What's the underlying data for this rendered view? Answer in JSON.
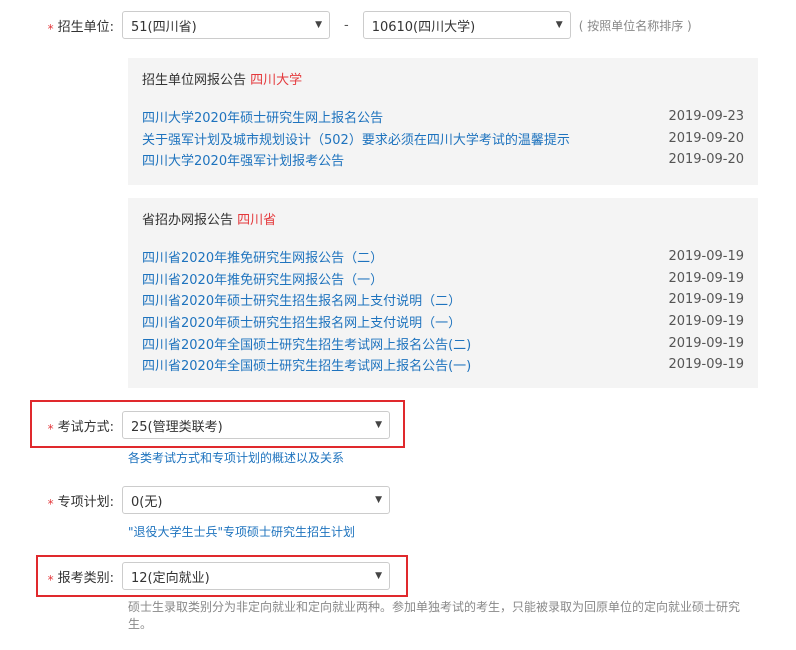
{
  "unit": {
    "label": "招生单位:",
    "province_value": "51(四川省)",
    "school_value": "10610(四川大学)",
    "hint": "( 按照单位名称排序 )"
  },
  "school_notices": {
    "title_prefix": "招生单位网报公告",
    "title_highlight": "四川大学",
    "items": [
      {
        "text": "四川大学2020年硕士研究生网上报名公告",
        "date": "2019-09-23"
      },
      {
        "text": "关于强军计划及城市规划设计（502）要求必须在四川大学考试的温馨提示",
        "date": "2019-09-20"
      },
      {
        "text": "四川大学2020年强军计划报考公告",
        "date": "2019-09-20"
      }
    ]
  },
  "province_notices": {
    "title_prefix": "省招办网报公告",
    "title_highlight": "四川省",
    "items": [
      {
        "text": "四川省2020年推免研究生网报公告（二）",
        "date": "2019-09-19"
      },
      {
        "text": "四川省2020年推免研究生网报公告（一）",
        "date": "2019-09-19"
      },
      {
        "text": "四川省2020年硕士研究生招生报名网上支付说明（二）",
        "date": "2019-09-19"
      },
      {
        "text": "四川省2020年硕士研究生招生报名网上支付说明（一）",
        "date": "2019-09-19"
      },
      {
        "text": "四川省2020年全国硕士研究生招生考试网上报名公告(二)",
        "date": "2019-09-19"
      },
      {
        "text": "四川省2020年全国硕士研究生招生考试网上报名公告(一)",
        "date": "2019-09-19"
      }
    ]
  },
  "exam_mode": {
    "label": "考试方式:",
    "value": "25(管理类联考)",
    "link": "各类考试方式和专项计划的概述以及关系"
  },
  "special_plan": {
    "label": "专项计划:",
    "value": "0(无)",
    "link": "\"退役大学生士兵\"专项硕士研究生招生计划"
  },
  "category": {
    "label": "报考类别:",
    "value": "12(定向就业)",
    "note": "硕士生录取类别分为非定向就业和定向就业两种。参加单独考试的考生，只能被录取为回原单位的定向就业硕士研究生。"
  },
  "colors": {
    "accent_red": "#e4393c",
    "link_blue": "#1e73be",
    "highlight_box": "#e0292d"
  }
}
